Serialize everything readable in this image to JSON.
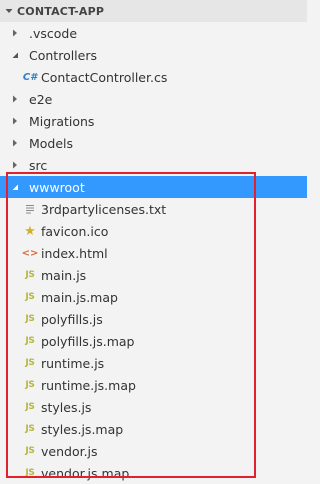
{
  "explorer": {
    "title": "CONTACT-APP"
  },
  "colors": {
    "selection": "#3399ff",
    "highlight_border": "#e0212f",
    "js_icon": "#b7b73b",
    "cs_icon": "#2f80c9",
    "html_icon": "#d86b3a",
    "favicon_star": "#cfb02a"
  },
  "tree": {
    "folders": [
      {
        "label": ".vscode",
        "state": "collapsed",
        "icon": "chevron-right-icon"
      },
      {
        "label": "Controllers",
        "state": "expanded",
        "icon": "chevron-down-icon"
      },
      {
        "label": "e2e",
        "state": "collapsed",
        "icon": "chevron-right-icon"
      },
      {
        "label": "Migrations",
        "state": "collapsed",
        "icon": "chevron-right-icon"
      },
      {
        "label": "Models",
        "state": "collapsed",
        "icon": "chevron-right-icon"
      },
      {
        "label": "src",
        "state": "collapsed",
        "icon": "chevron-right-icon"
      },
      {
        "label": "wwwroot",
        "state": "expanded",
        "icon": "chevron-down-icon",
        "selected": true
      }
    ],
    "controllers_files": [
      {
        "label": "ContactController.cs",
        "icon": "csharp-file-icon",
        "glyph": "C#"
      }
    ],
    "wwwroot_files": [
      {
        "label": "3rdpartylicenses.txt",
        "icon": "text-file-icon",
        "glyph": ""
      },
      {
        "label": "favicon.ico",
        "icon": "star-icon",
        "glyph": "★"
      },
      {
        "label": "index.html",
        "icon": "html-file-icon",
        "glyph": "<>"
      },
      {
        "label": "main.js",
        "icon": "js-file-icon",
        "glyph": "JS"
      },
      {
        "label": "main.js.map",
        "icon": "js-file-icon",
        "glyph": "JS"
      },
      {
        "label": "polyfills.js",
        "icon": "js-file-icon",
        "glyph": "JS"
      },
      {
        "label": "polyfills.js.map",
        "icon": "js-file-icon",
        "glyph": "JS"
      },
      {
        "label": "runtime.js",
        "icon": "js-file-icon",
        "glyph": "JS"
      },
      {
        "label": "runtime.js.map",
        "icon": "js-file-icon",
        "glyph": "JS"
      },
      {
        "label": "styles.js",
        "icon": "js-file-icon",
        "glyph": "JS"
      },
      {
        "label": "styles.js.map",
        "icon": "js-file-icon",
        "glyph": "JS"
      },
      {
        "label": "vendor.js",
        "icon": "js-file-icon",
        "glyph": "JS"
      },
      {
        "label": "vendor.js.map",
        "icon": "js-file-icon",
        "glyph": "JS"
      }
    ]
  }
}
